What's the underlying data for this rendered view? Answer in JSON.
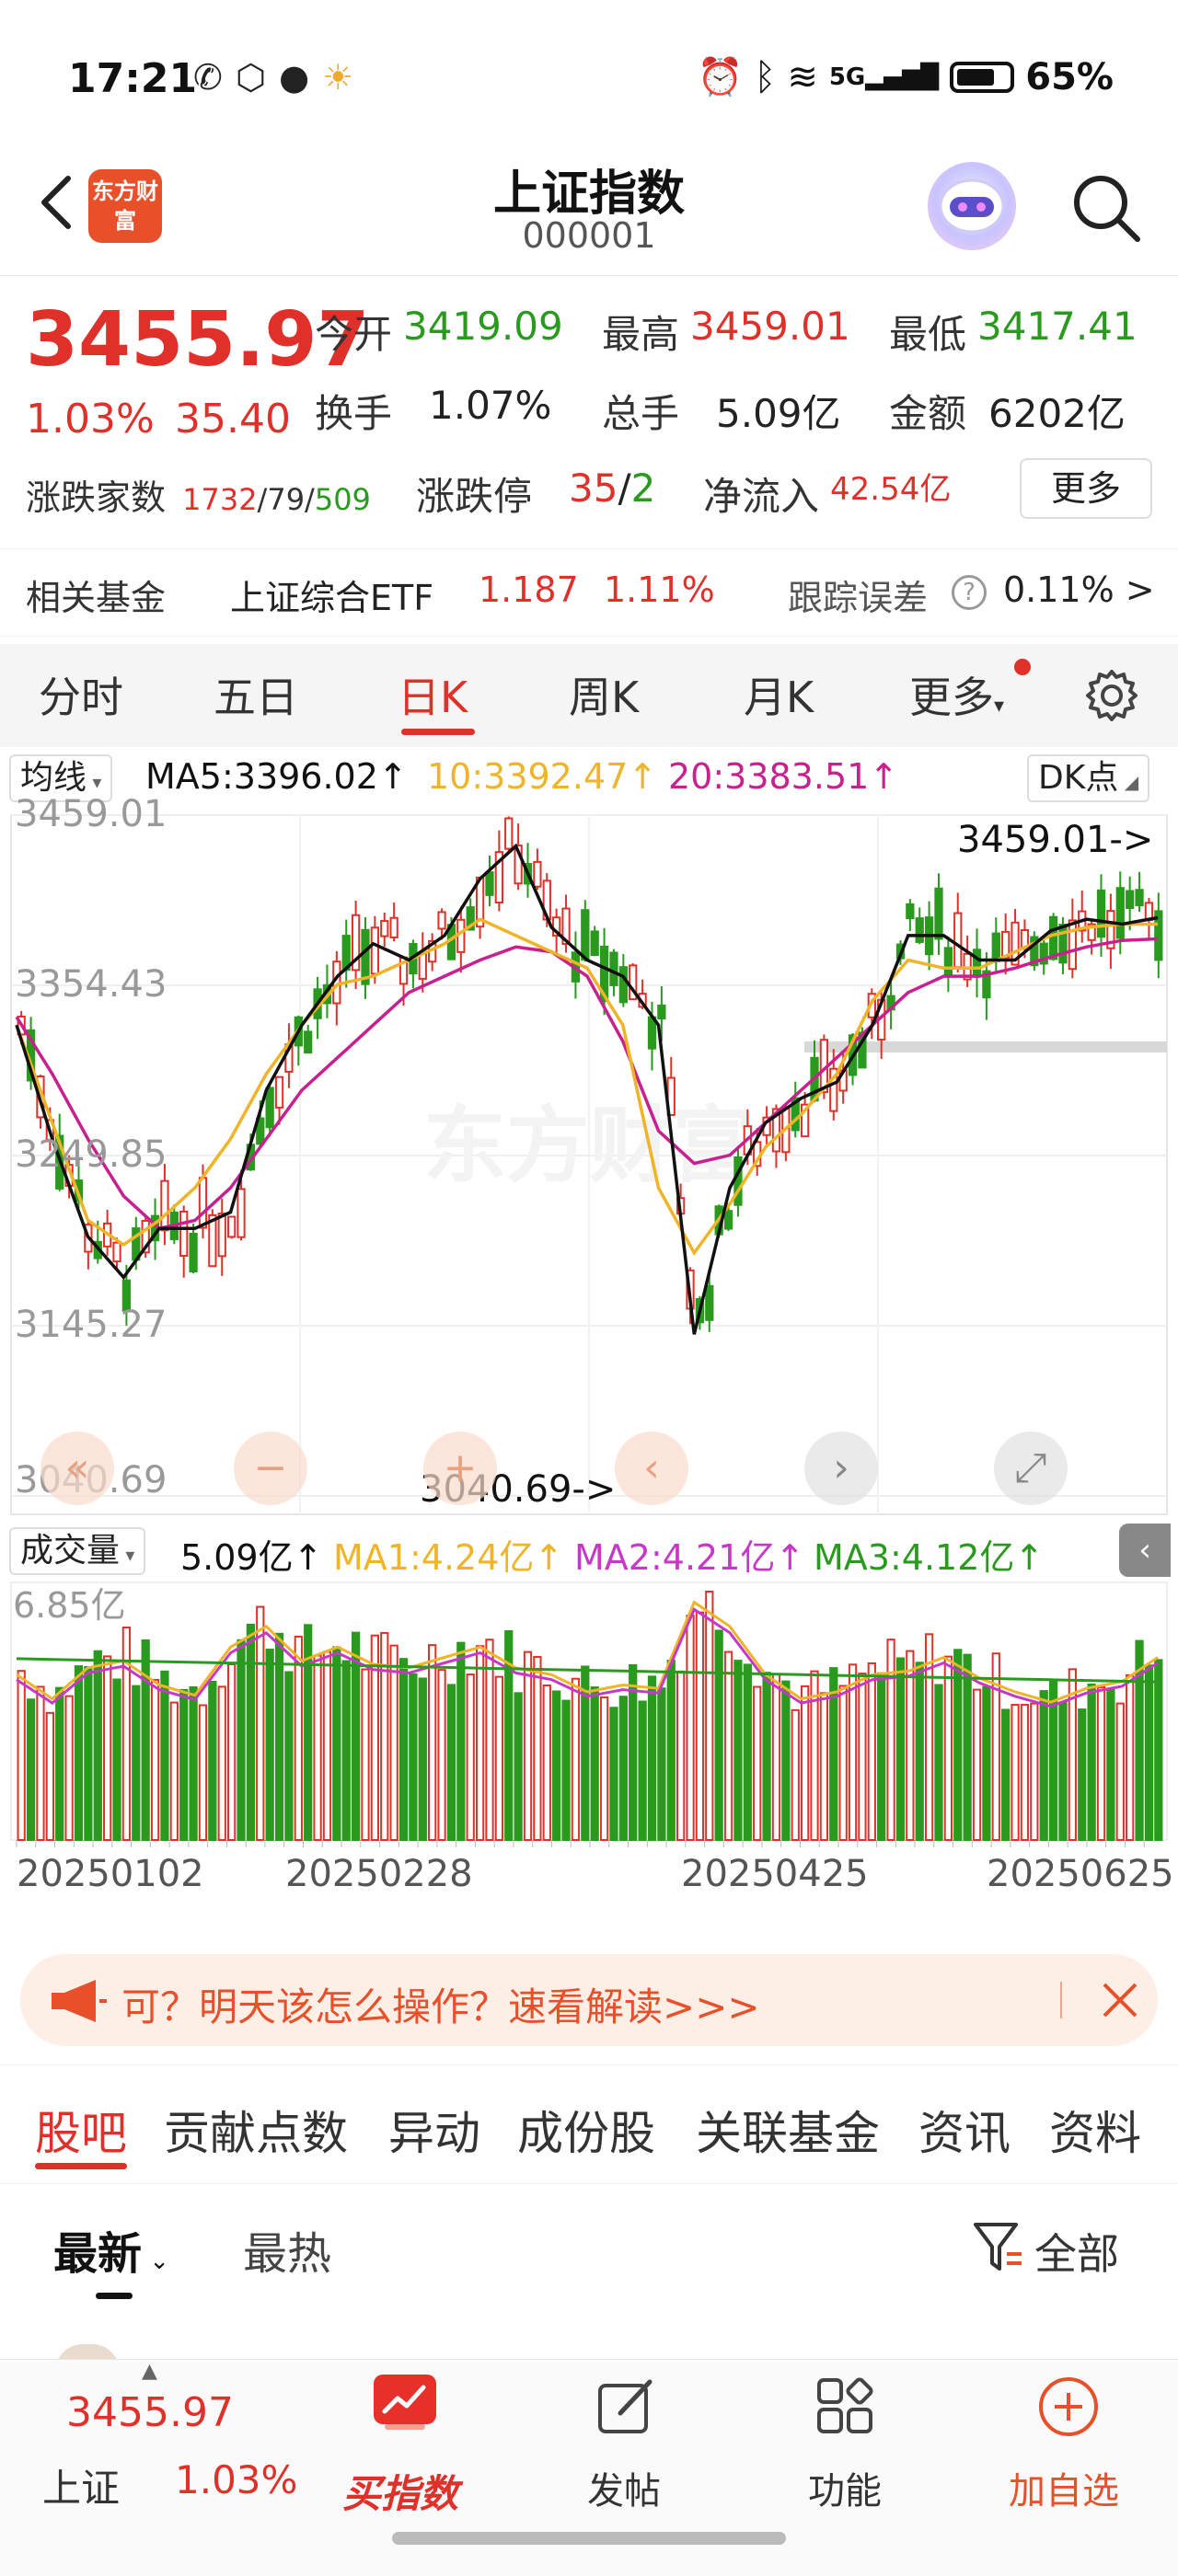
{
  "status": {
    "time": "17:21",
    "network": "5G",
    "battery": "65%"
  },
  "header": {
    "logo_text": "东方财富",
    "title": "上证指数",
    "code": "000001"
  },
  "quote": {
    "price": "3455.97",
    "change_pct": "1.03%",
    "change_pts": "35.40",
    "open_label": "今开",
    "open": "3419.09",
    "high_label": "最高",
    "high": "3459.01",
    "low_label": "最低",
    "low": "3417.41",
    "turnover_label": "换手",
    "turnover": "1.07%",
    "volume_label": "总手",
    "volume": "5.09亿",
    "amount_label": "金额",
    "amount": "6202亿",
    "advance_label": "涨跌家数",
    "advance_up": "1732",
    "advance_flat": "79",
    "advance_down": "509",
    "limit_label": "涨跌停",
    "limit_up": "35",
    "limit_down": "2",
    "inflow_label": "净流入",
    "inflow": "42.54亿",
    "more_button": "更多"
  },
  "fund_row": {
    "label": "相关基金",
    "fund_name": "上证综合ETF",
    "fund_price": "1.187",
    "fund_pct": "1.11%",
    "track_label": "跟踪误差",
    "track_value": "0.11% >"
  },
  "period_tabs": [
    "分时",
    "五日",
    "日K",
    "周K",
    "月K",
    "更多"
  ],
  "ma": {
    "dropdown": "均线",
    "ma5": "MA5:3396.02↑",
    "ma10": "10:3392.47↑",
    "ma20": "20:3383.51↑",
    "dk_button": "DK点"
  },
  "volume_row": {
    "dropdown": "成交量",
    "value": "5.09亿↑",
    "ma1": "MA1:4.24亿↑",
    "ma2": "MA2:4.21亿↑",
    "ma3": "MA3:4.12亿↑"
  },
  "colors": {
    "up": "#e0302a",
    "down": "#2a9a1f",
    "ma5": "#111111",
    "ma10": "#f0b429",
    "ma20": "#c8208e",
    "accent": "#e8502a"
  },
  "chart_data": {
    "type": "candlestick",
    "y_ticks": [
      "3459.01",
      "3354.43",
      "3249.85",
      "3145.27",
      "3040.69"
    ],
    "ylim": [
      3040.69,
      3459.01
    ],
    "high_label": "3459.01->",
    "low_label": "3040.69->",
    "watermark": "东方财富",
    "x_labels": [
      "20250102",
      "20250228",
      "20250425",
      "20250625"
    ],
    "ma5": [
      3330,
      3260,
      3200,
      3175,
      3205,
      3205,
      3215,
      3290,
      3330,
      3360,
      3380,
      3370,
      3385,
      3420,
      3440,
      3390,
      3370,
      3360,
      3330,
      3140,
      3230,
      3270,
      3285,
      3295,
      3330,
      3385,
      3385,
      3370,
      3370,
      3388,
      3395,
      3392,
      3396
    ],
    "ma10": [
      3330,
      3270,
      3210,
      3195,
      3210,
      3230,
      3260,
      3300,
      3330,
      3355,
      3360,
      3370,
      3380,
      3395,
      3385,
      3375,
      3365,
      3330,
      3230,
      3190,
      3220,
      3255,
      3275,
      3300,
      3345,
      3370,
      3365,
      3365,
      3375,
      3385,
      3390,
      3392,
      3392
    ],
    "ma20": [
      3335,
      3300,
      3260,
      3225,
      3205,
      3210,
      3230,
      3260,
      3290,
      3310,
      3330,
      3350,
      3360,
      3370,
      3378,
      3375,
      3360,
      3320,
      3265,
      3245,
      3250,
      3270,
      3290,
      3310,
      3330,
      3350,
      3360,
      3360,
      3365,
      3372,
      3378,
      3382,
      3383
    ],
    "volume": {
      "y_tick": "6.85亿",
      "values": [
        4.8,
        4.1,
        5.0,
        5.2,
        4.5,
        4.2,
        5.6,
        6.2,
        5.2,
        5.6,
        5.1,
        5.0,
        5.3,
        5.6,
        5.0,
        4.8,
        4.3,
        4.5,
        4.4,
        6.9,
        6.2,
        4.8,
        4.1,
        4.3,
        4.8,
        4.9,
        5.3,
        4.7,
        4.3,
        4.0,
        4.4,
        4.6,
        5.3
      ]
    }
  },
  "banner": {
    "text": "可？明天该怎么操作？速看解读>>>"
  },
  "sub_tabs": [
    "股吧",
    "贡献点数",
    "异动",
    "成份股",
    "关联基金",
    "资讯",
    "资料"
  ],
  "filter": {
    "latest": "最新",
    "hot": "最热",
    "all": "全部"
  },
  "bottom": {
    "index_price": "3455.97",
    "index_name": "上证",
    "index_pct": "1.03%",
    "buy_index": "买指数",
    "post": "发帖",
    "function": "功能",
    "add_watch": "加自选"
  }
}
